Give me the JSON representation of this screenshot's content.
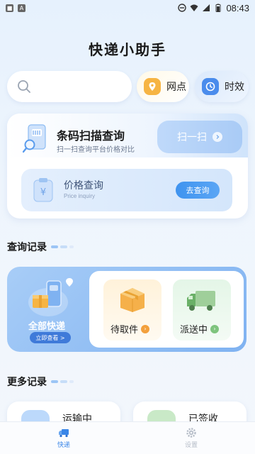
{
  "status_bar": {
    "time": "08:43",
    "icon_a": "A"
  },
  "header": {
    "title": "快递小助手"
  },
  "search": {
    "placeholder": ""
  },
  "quick": {
    "outlets_label": "网点",
    "timeliness_label": "时效"
  },
  "scan": {
    "title": "条码扫描查询",
    "subtitle": "扫一扫查询平台价格对比",
    "button_label": "扫一扫"
  },
  "price": {
    "title": "价格查询",
    "subtitle": "Price inquiry",
    "button_label": "去查询"
  },
  "records": {
    "section_title": "查询记录",
    "all_label": "全部快递",
    "view_label": "立即查看 >",
    "pending_label": "待取件",
    "delivering_label": "派送中"
  },
  "more": {
    "section_title": "更多记录",
    "in_transit_label": "运输中",
    "signed_label": "已签收"
  },
  "tabbar": {
    "home_label": "快递",
    "settings_label": "设置"
  },
  "colors": {
    "accent": "#3a86e8",
    "orange": "#f3a03c",
    "green": "#7ec47d"
  }
}
